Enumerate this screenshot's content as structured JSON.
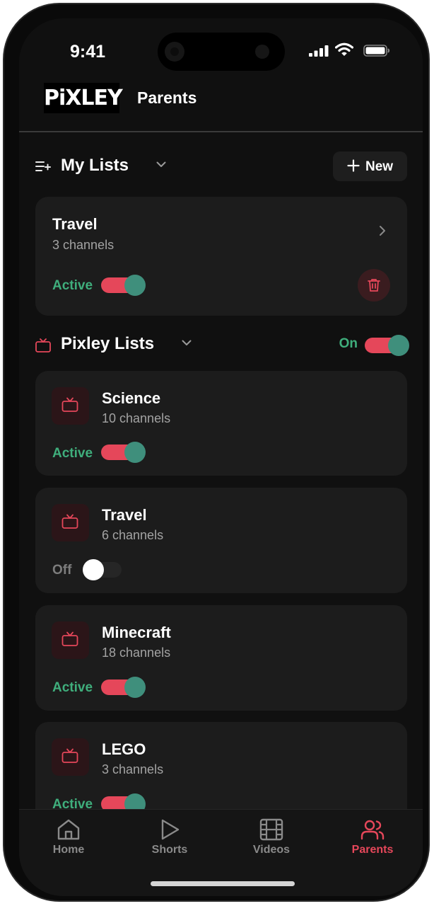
{
  "status_bar": {
    "time": "9:41"
  },
  "header": {
    "logo_text": "PiXLEY",
    "title": "Parents"
  },
  "my_lists": {
    "title": "My Lists",
    "new_button": "New",
    "items": [
      {
        "name": "Travel",
        "count": "3 channels",
        "status": "Active",
        "enabled": true
      }
    ]
  },
  "pixley_lists": {
    "title": "Pixley Lists",
    "master_label": "On",
    "master_enabled": true,
    "items": [
      {
        "name": "Science",
        "count": "10 channels",
        "status": "Active",
        "enabled": true
      },
      {
        "name": "Travel",
        "count": "6 channels",
        "status": "Off",
        "enabled": false
      },
      {
        "name": "Minecraft",
        "count": "18 channels",
        "status": "Active",
        "enabled": true
      },
      {
        "name": "LEGO",
        "count": "3 channels",
        "status": "Active",
        "enabled": true
      }
    ]
  },
  "tabbar": {
    "items": [
      {
        "label": "Home",
        "icon": "home-icon"
      },
      {
        "label": "Shorts",
        "icon": "play-icon"
      },
      {
        "label": "Videos",
        "icon": "film-icon"
      },
      {
        "label": "Parents",
        "icon": "users-icon",
        "active": true
      }
    ]
  },
  "colors": {
    "accent": "#e5475a",
    "active_green": "#3fae7c",
    "knob": "#3f8f7c",
    "background": "#101010",
    "card": "#1c1c1c"
  }
}
